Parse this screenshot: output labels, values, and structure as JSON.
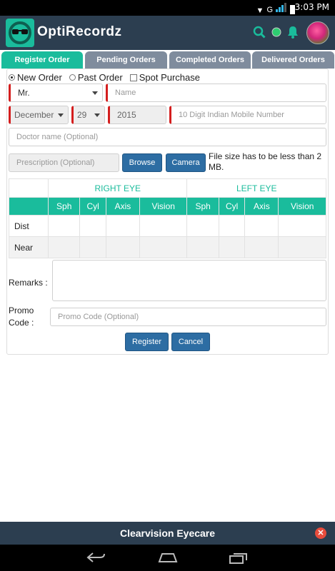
{
  "status": {
    "time": "3:03 PM",
    "network": "G"
  },
  "header": {
    "title": "OptiRecordz",
    "online_color": "#2ecc71",
    "accent": "#1abc9c"
  },
  "tabs": [
    {
      "label": "Register Order",
      "active": true
    },
    {
      "label": "Pending Orders"
    },
    {
      "label": "Completed Orders"
    },
    {
      "label": "Delivered Orders"
    }
  ],
  "order_type": {
    "options": [
      "New Order",
      "Past Order"
    ],
    "selected": "New Order",
    "spot_label": "Spot Purchase"
  },
  "form": {
    "title_value": "Mr.",
    "name_placeholder": "Name",
    "month_value": "December",
    "day_value": "29",
    "year_value": "2015",
    "mobile_placeholder": "10 Digit Indian Mobile Number",
    "doctor_placeholder": "Doctor name (Optional)",
    "prescription_placeholder": "Prescription (Optional)",
    "browse_label": "Browse",
    "camera_label": "Camera",
    "file_note": "File size has to be less than 2 MB."
  },
  "grid": {
    "right_eye": "RIGHT EYE",
    "left_eye": "LEFT EYE",
    "columns": [
      "Sph",
      "Cyl",
      "Axis",
      "Vision"
    ],
    "rows": [
      "Dist",
      "Near"
    ]
  },
  "remarks_label": "Remarks :",
  "promo": {
    "label_line1": "Promo",
    "label_line2": "Code :",
    "placeholder": "Promo Code (Optional)"
  },
  "buttons": {
    "register": "Register",
    "cancel": "Cancel"
  },
  "footer": {
    "store": "Clearvision Eyecare"
  }
}
